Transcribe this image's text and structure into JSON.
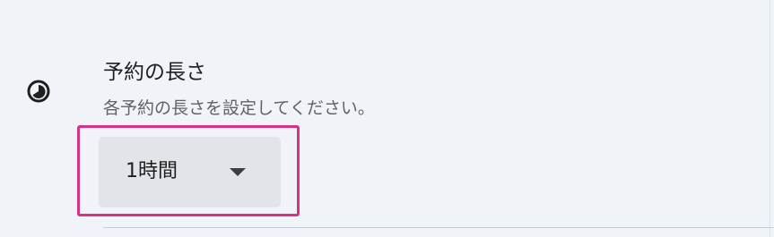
{
  "setting": {
    "icon": "clock-icon",
    "title": "予約の長さ",
    "description": "各予約の長さを設定してください。",
    "duration": {
      "selected": "1時間"
    }
  },
  "colors": {
    "background": "#f0f4f9",
    "dropdown_background": "#e1e5ea",
    "highlight_border": "#d63384",
    "title_text": "#1f1f1f",
    "description_text": "#5f6368"
  }
}
